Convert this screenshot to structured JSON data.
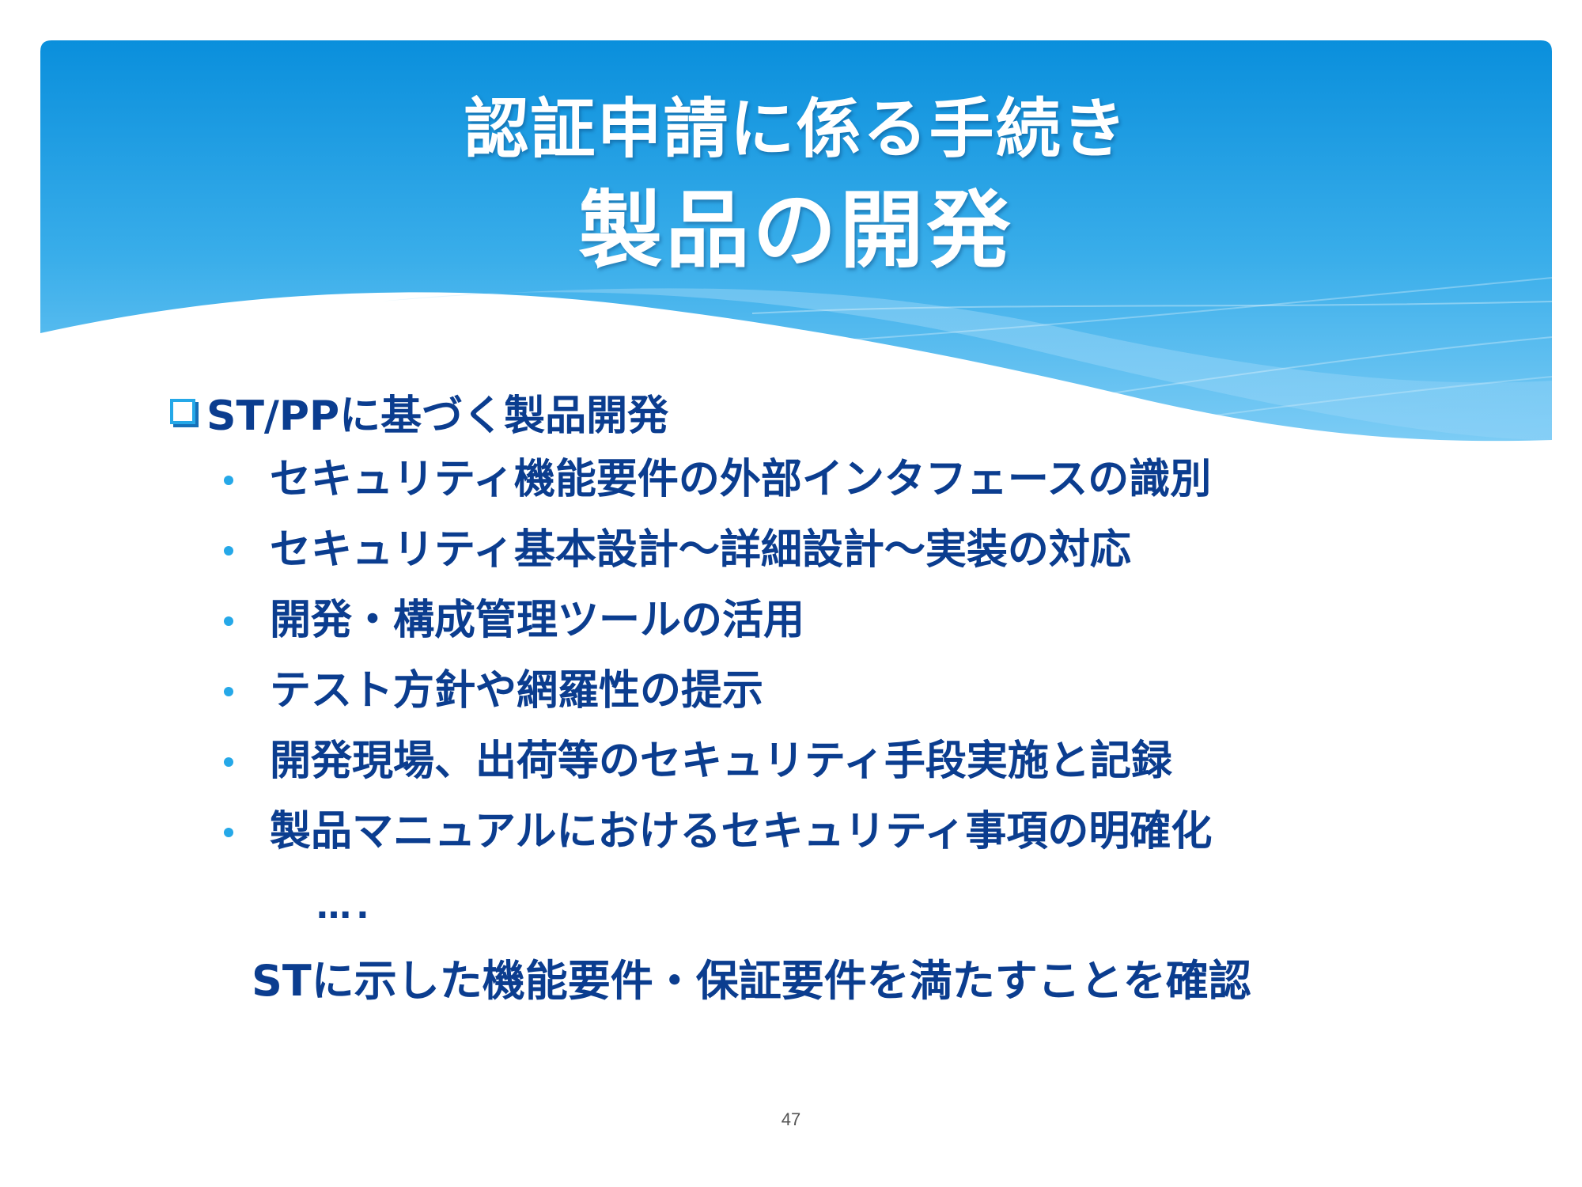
{
  "slide": {
    "title_line1": "認証申請に係る手続き",
    "title_line2": "製品の開発",
    "heading": "ST/PPに基づく製品開発",
    "bullets": [
      "セキュリティ機能要件の外部インタフェースの識別",
      "セキュリティ基本設計～詳細設計～実装の対応",
      "開発・構成管理ツールの活用",
      "テスト方針や網羅性の提示",
      "開発現場、出荷等のセキュリティ手段実施と記録",
      "製品マニュアルにおけるセキュリティ事項の明確化"
    ],
    "ellipsis": "….",
    "conclusion": "STに示した機能要件・保証要件を満たすことを確認",
    "page_number": "47"
  },
  "colors": {
    "header_top": "#0a8fdc",
    "header_bottom": "#5bbcf0",
    "text": "#0b3d8f",
    "bullet_accent": "#25a8e8"
  },
  "icons": {
    "heading_marker": "square-checkbox-icon",
    "bullet_marker": "bullet-dot-icon"
  }
}
